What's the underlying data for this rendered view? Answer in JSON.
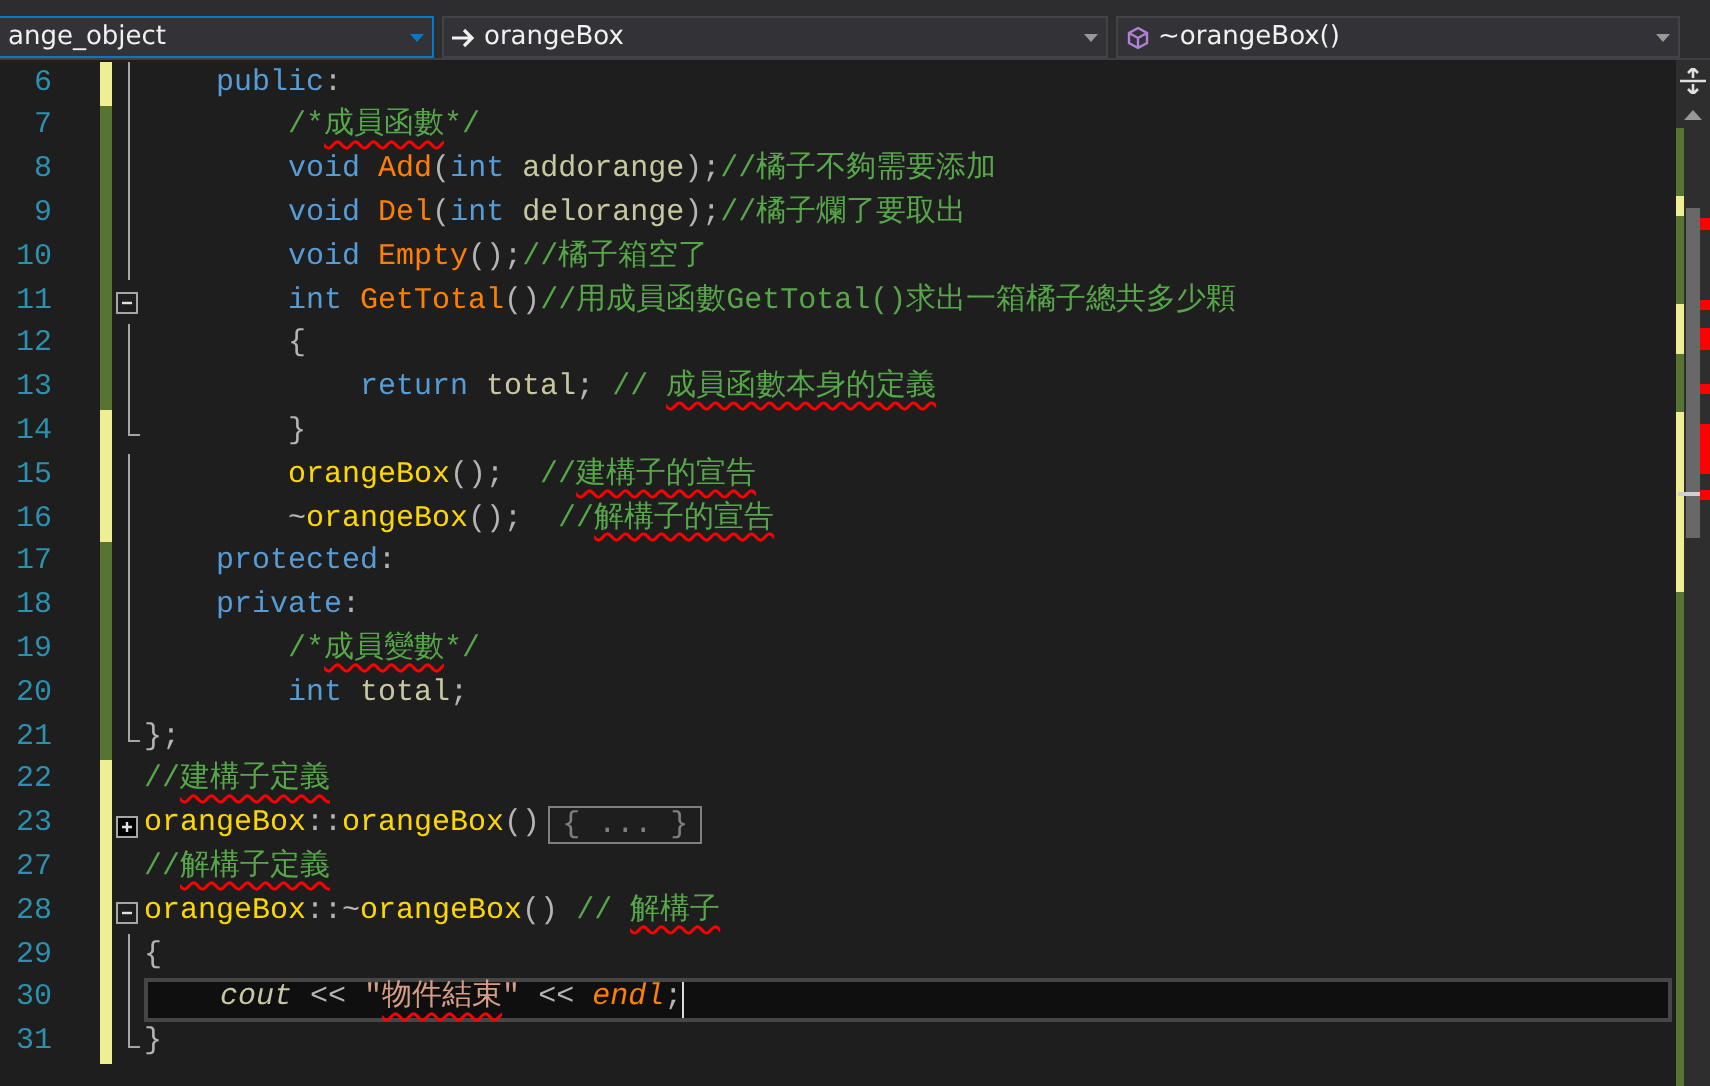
{
  "nav_bar": {
    "project": "ange_object",
    "type": "orangeBox",
    "member": "~orangeBox()"
  },
  "lines": [
    {
      "n": "6",
      "saved": false,
      "guide": true,
      "block_end": false,
      "tokens": [
        {
          "t": "    public",
          "kind": "kw"
        },
        {
          "t": ":",
          "kind": "p"
        }
      ]
    },
    {
      "n": "7",
      "saved": true,
      "guide": true,
      "block_end": false,
      "tokens": [
        {
          "t": "        /*",
          "kind": "c"
        },
        {
          "t": "成員函數",
          "kind": "c",
          "sq": true
        },
        {
          "t": "*/",
          "kind": "c"
        }
      ]
    },
    {
      "n": "8",
      "saved": true,
      "guide": true,
      "block_end": false,
      "tokens": [
        {
          "t": "        void ",
          "kind": "kw"
        },
        {
          "t": "Add",
          "kind": "fn"
        },
        {
          "t": "(",
          "kind": "p"
        },
        {
          "t": "int ",
          "kind": "kw"
        },
        {
          "t": "addorange",
          "kind": "id"
        },
        {
          "t": ");",
          "kind": "p"
        },
        {
          "t": "//橘子不夠需要添加",
          "kind": "c"
        }
      ]
    },
    {
      "n": "9",
      "saved": true,
      "guide": true,
      "block_end": false,
      "tokens": [
        {
          "t": "        void ",
          "kind": "kw"
        },
        {
          "t": "Del",
          "kind": "fn"
        },
        {
          "t": "(",
          "kind": "p"
        },
        {
          "t": "int ",
          "kind": "kw"
        },
        {
          "t": "delorange",
          "kind": "id"
        },
        {
          "t": ");",
          "kind": "p"
        },
        {
          "t": "//橘子爛了要取出",
          "kind": "c"
        }
      ]
    },
    {
      "n": "10",
      "saved": true,
      "guide": true,
      "block_end": false,
      "tokens": [
        {
          "t": "        void ",
          "kind": "kw"
        },
        {
          "t": "Empty",
          "kind": "fn"
        },
        {
          "t": "();",
          "kind": "p"
        },
        {
          "t": "//橘子箱空了",
          "kind": "c"
        }
      ]
    },
    {
      "n": "11",
      "saved": true,
      "expanded": true,
      "tokens": [
        {
          "t": "        int ",
          "kind": "kw"
        },
        {
          "t": "GetTotal",
          "kind": "fn"
        },
        {
          "t": "()",
          "kind": "p"
        },
        {
          "t": "//用成員函數GetTotal()求出一箱橘子總共多少顆",
          "kind": "c"
        }
      ]
    },
    {
      "n": "12",
      "saved": true,
      "guide": true,
      "block_end": false,
      "tokens": [
        {
          "t": "        {",
          "kind": "p"
        }
      ]
    },
    {
      "n": "13",
      "saved": true,
      "guide": true,
      "block_end": false,
      "tokens": [
        {
          "t": "            return ",
          "kind": "kw"
        },
        {
          "t": "total",
          "kind": "id"
        },
        {
          "t": "; ",
          "kind": "p"
        },
        {
          "t": "// ",
          "kind": "c"
        },
        {
          "t": "成員函數本身的定義",
          "kind": "c",
          "sq": true
        }
      ]
    },
    {
      "n": "14",
      "saved": false,
      "guide": false,
      "block_end": true,
      "tokens": [
        {
          "t": "        }",
          "kind": "p"
        }
      ]
    },
    {
      "n": "15",
      "saved": false,
      "guide": true,
      "block_end": false,
      "tokens": [
        {
          "t": "        orangeBox",
          "kind": "ctor"
        },
        {
          "t": "();  ",
          "kind": "p"
        },
        {
          "t": "//",
          "kind": "c"
        },
        {
          "t": "建構子的宣告",
          "kind": "c",
          "sq": true
        }
      ]
    },
    {
      "n": "16",
      "saved": false,
      "guide": true,
      "block_end": false,
      "tokens": [
        {
          "t": "        ~",
          "kind": "p"
        },
        {
          "t": "orangeBox",
          "kind": "ctor"
        },
        {
          "t": "();  ",
          "kind": "p"
        },
        {
          "t": "//",
          "kind": "c"
        },
        {
          "t": "解構子的宣告",
          "kind": "c",
          "sq": true
        }
      ]
    },
    {
      "n": "17",
      "saved": true,
      "guide": true,
      "block_end": false,
      "tokens": [
        {
          "t": "    protected",
          "kind": "kw"
        },
        {
          "t": ":",
          "kind": "p"
        }
      ]
    },
    {
      "n": "18",
      "saved": true,
      "guide": true,
      "block_end": false,
      "tokens": [
        {
          "t": "    private",
          "kind": "kw"
        },
        {
          "t": ":",
          "kind": "p"
        }
      ]
    },
    {
      "n": "19",
      "saved": true,
      "guide": true,
      "block_end": false,
      "tokens": [
        {
          "t": "        /*",
          "kind": "c"
        },
        {
          "t": "成員變數",
          "kind": "c",
          "sq": true
        },
        {
          "t": "*/",
          "kind": "c"
        }
      ]
    },
    {
      "n": "20",
      "saved": true,
      "guide": true,
      "block_end": false,
      "tokens": [
        {
          "t": "        int ",
          "kind": "kw"
        },
        {
          "t": "total",
          "kind": "id"
        },
        {
          "t": ";",
          "kind": "p"
        }
      ]
    },
    {
      "n": "21",
      "saved": true,
      "guide": false,
      "block_end": true,
      "tokens": [
        {
          "t": "};",
          "kind": "p"
        }
      ]
    },
    {
      "n": "22",
      "saved": false,
      "guide": false,
      "block_end": false,
      "tokens": [
        {
          "t": "//",
          "kind": "c"
        },
        {
          "t": "建構子定義",
          "kind": "c",
          "sq": true
        }
      ]
    },
    {
      "n": "23",
      "saved": false,
      "expanded": false,
      "tokens": [
        {
          "t": "orangeBox",
          "kind": "ctor"
        },
        {
          "t": "::",
          "kind": "p"
        },
        {
          "t": "orangeBox",
          "kind": "ctor"
        },
        {
          "t": "()",
          "kind": "p"
        },
        {
          "t": "{ ... }",
          "kind": "collapsed"
        }
      ]
    },
    {
      "n": "27",
      "saved": false,
      "guide": false,
      "block_end": false,
      "tokens": [
        {
          "t": "//",
          "kind": "c"
        },
        {
          "t": "解構子定義",
          "kind": "c",
          "sq": true
        }
      ]
    },
    {
      "n": "28",
      "saved": false,
      "expanded": true,
      "tokens": [
        {
          "t": "orangeBox",
          "kind": "ctor"
        },
        {
          "t": "::~",
          "kind": "p"
        },
        {
          "t": "orangeBox",
          "kind": "ctor"
        },
        {
          "t": "() ",
          "kind": "p"
        },
        {
          "t": "// ",
          "kind": "c"
        },
        {
          "t": "解構子",
          "kind": "c",
          "sq": true
        }
      ]
    },
    {
      "n": "29",
      "saved": false,
      "guide": true,
      "block_end": false,
      "tokens": [
        {
          "t": "{",
          "kind": "p"
        }
      ]
    },
    {
      "n": "30",
      "saved": false,
      "guide": true,
      "block_end": false,
      "current": true,
      "tokens": [
        {
          "t": "    cout",
          "kind": "obj"
        },
        {
          "t": " << ",
          "kind": "p"
        },
        {
          "t": "\"",
          "kind": "s"
        },
        {
          "t": "物件結束",
          "kind": "s",
          "sq": true
        },
        {
          "t": "\"",
          "kind": "s"
        },
        {
          "t": " << ",
          "kind": "p"
        },
        {
          "t": "endl",
          "kind": "macro"
        },
        {
          "t": ";",
          "kind": "p"
        }
      ]
    },
    {
      "n": "31",
      "saved": false,
      "guide": false,
      "block_end": true,
      "tokens": [
        {
          "t": "}",
          "kind": "p"
        }
      ]
    }
  ]
}
